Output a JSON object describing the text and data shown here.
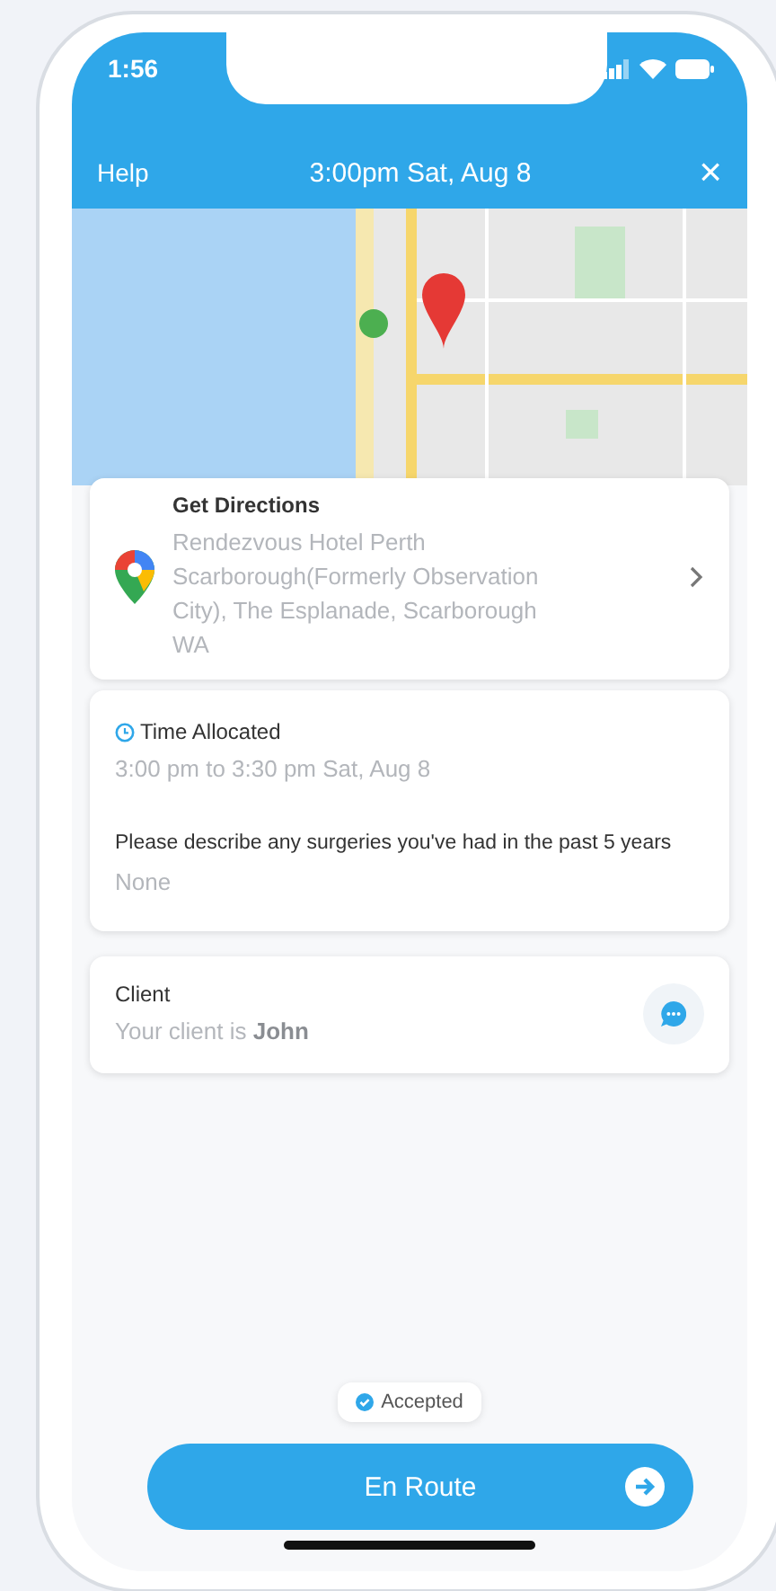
{
  "status_bar": {
    "time": "1:56"
  },
  "header": {
    "left": "Help",
    "title": "3:00pm Sat, Aug 8",
    "close": "×"
  },
  "directions": {
    "title": "Get Directions",
    "address": "Rendezvous Hotel Perth Scarborough(Formerly Observation City), The Esplanade, Scarborough WA"
  },
  "details": {
    "time_label": "Time Allocated",
    "time_value": "3:00 pm to 3:30 pm Sat, Aug 8",
    "question": "Please describe any surgeries you've had in the past 5 years",
    "answer": "None"
  },
  "client": {
    "label": "Client",
    "text": "Your client is **John**"
  },
  "status": {
    "label": "Accepted"
  },
  "action": {
    "label": "En Route"
  }
}
